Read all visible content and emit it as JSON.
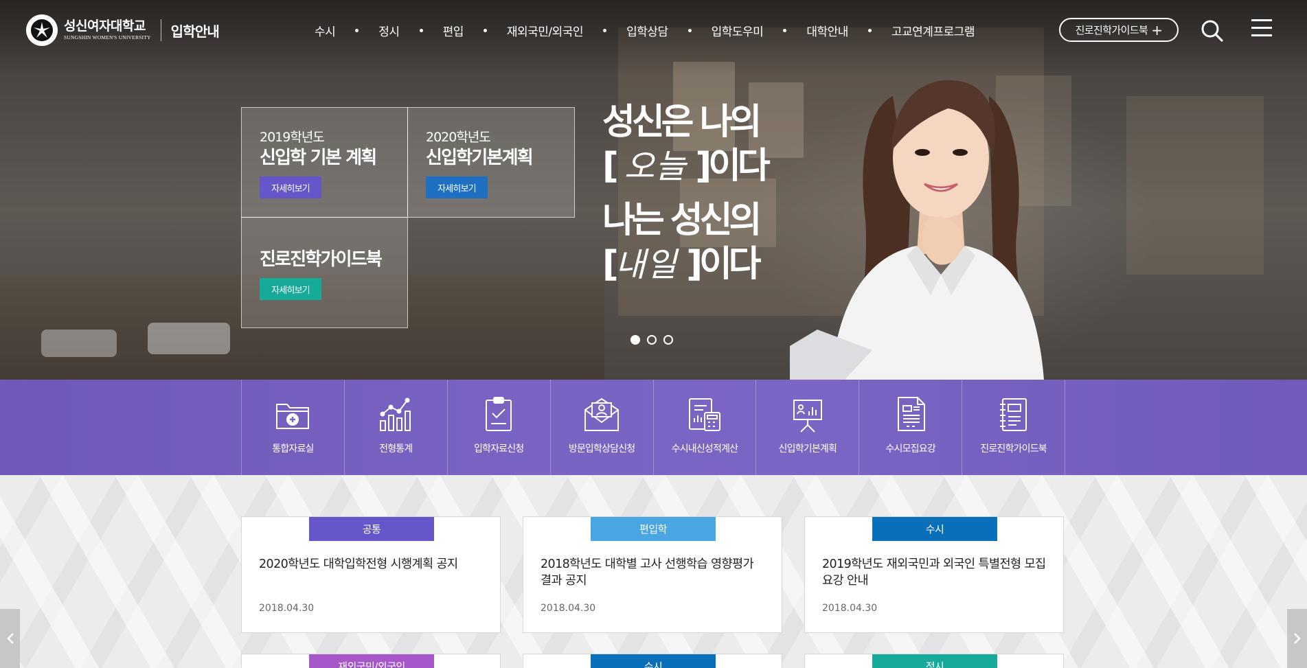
{
  "header": {
    "logo_kr": "성신여자대학교",
    "logo_en": "SUNGSHIN WOMEN'S UNIVERSITY",
    "site_title": "입학안내",
    "nav": [
      "수시",
      "정시",
      "편입",
      "재외국민/외국인",
      "입학상담",
      "입학도우미",
      "대학안내",
      "고교연계프로그램"
    ],
    "guide_button": "진로진학가이드북",
    "guide_plus": "+",
    "search_icon": "search-icon",
    "menu_icon": "hamburger-menu-icon"
  },
  "hero": {
    "boxes": [
      {
        "year": "2019학년도",
        "title": "신입학 기본 계획",
        "more": "자세히보기",
        "color": "#6556c9"
      },
      {
        "year": "2020학년도",
        "title": "신입학기본계획",
        "more": "자세히보기",
        "color": "#1f6fc2"
      },
      {
        "year": "",
        "title": "진로진학가이드북",
        "more": "자세히보기",
        "color": "#17a99a"
      }
    ],
    "slogan": {
      "line1": "성신은 나의",
      "line2_open": "[",
      "line2_hand": "오늘",
      "line2_close": "]이다",
      "line3": "나는 성신의",
      "line4_open": "[",
      "line4_hand": "내일",
      "line4_close": "]이다"
    },
    "slides": 3,
    "active_slide": 1
  },
  "quick_menu": [
    {
      "label": "통합자료실",
      "icon": "folder-plus-icon"
    },
    {
      "label": "전형통계",
      "icon": "bar-chart-icon"
    },
    {
      "label": "입학자료신청",
      "icon": "clipboard-check-icon"
    },
    {
      "label": "방문입학상담신청",
      "icon": "envelope-person-icon"
    },
    {
      "label": "수시내신성적계산",
      "icon": "calculator-report-icon"
    },
    {
      "label": "신입학기본계획",
      "icon": "presentation-board-icon"
    },
    {
      "label": "수시모집요강",
      "icon": "document-list-icon"
    },
    {
      "label": "진로진학가이드북",
      "icon": "notebook-icon"
    }
  ],
  "notices": [
    {
      "category": "공통",
      "color": "#6556c9",
      "title": "2020학년도 대학입학전형 시행계획 공지",
      "date": "2018.04.30"
    },
    {
      "category": "편입학",
      "color": "#4aa6e3",
      "title": "2018학년도 대학별 고사 선행학습 영향평가 결과 공지",
      "date": "2018.04.30"
    },
    {
      "category": "수시",
      "color": "#0a6fba",
      "title": "2019학년도 재외국민과 외국인 특별전형 모집요강 안내",
      "date": "2018.04.30"
    },
    {
      "category": "재외국민/외국인",
      "color": "#a657c9",
      "title": "",
      "date": ""
    },
    {
      "category": "수시",
      "color": "#0a6fba",
      "title": "",
      "date": ""
    },
    {
      "category": "정시",
      "color": "#17a99a",
      "title": "",
      "date": ""
    }
  ],
  "arrows": {
    "prev": "chevron-left-icon",
    "next": "chevron-right-icon"
  }
}
